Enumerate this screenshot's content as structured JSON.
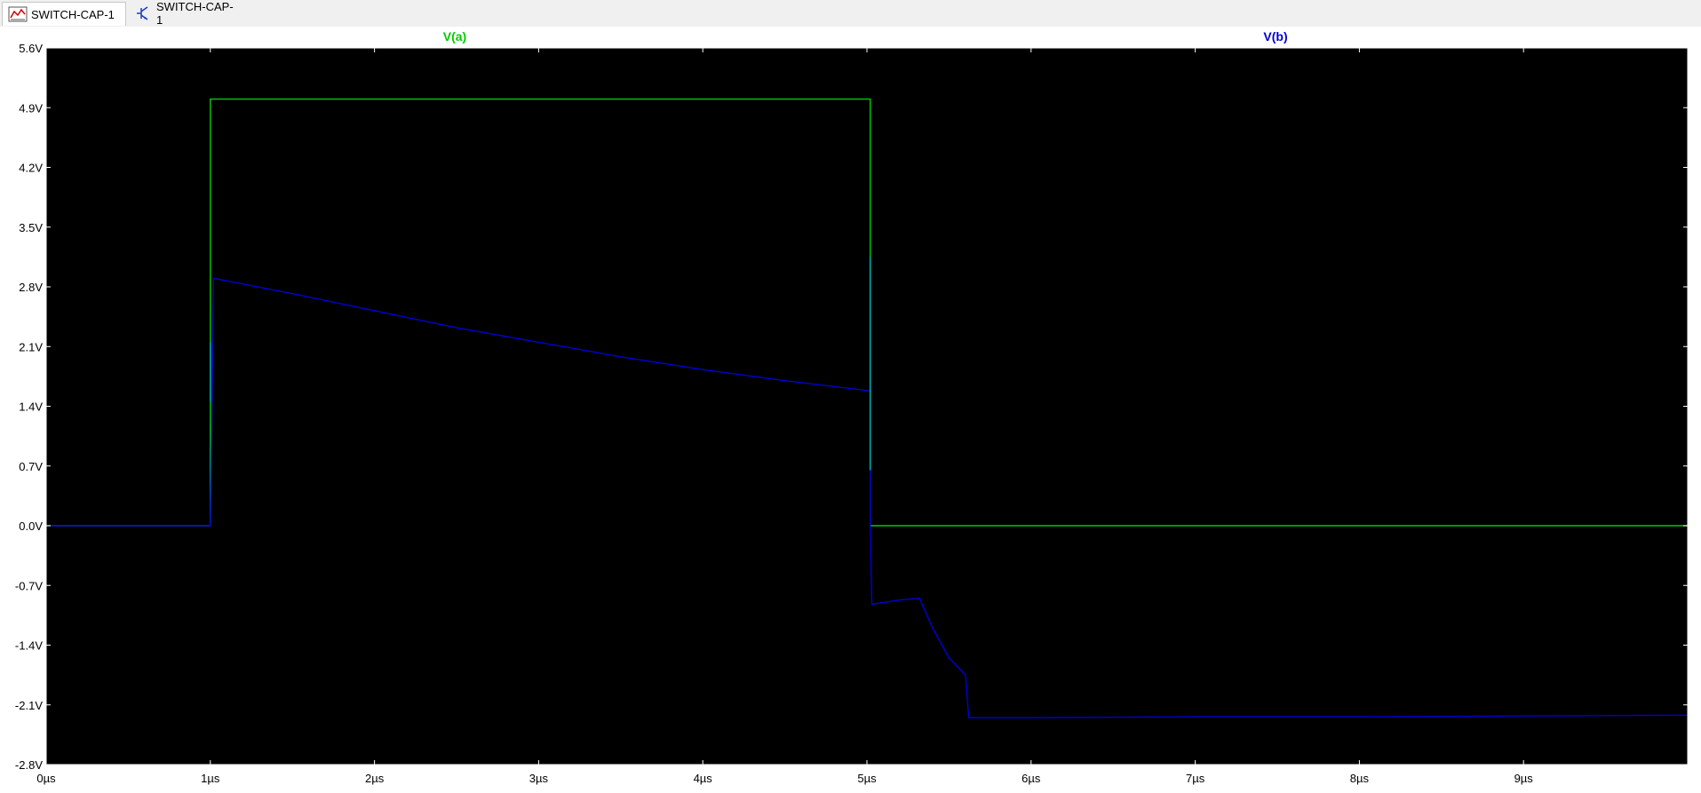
{
  "tabs": [
    {
      "label": "SWITCH-CAP-1",
      "icon": "waveform-icon",
      "active": true
    },
    {
      "label": "SWITCH-CAP-1",
      "icon": "schematic-icon",
      "active": false
    }
  ],
  "colors": {
    "plot_background": "#000000",
    "axis_text": "#ffffff",
    "frame": "#ffffff",
    "va_trace": "#00cc00",
    "vb_trace": "#0000d8",
    "vb_glitch": "#00aaaa"
  },
  "chart_data": {
    "type": "line",
    "title": "",
    "xlabel": "",
    "ylabel": "",
    "xlim": [
      0,
      10
    ],
    "ylim": [
      -2.8,
      5.6
    ],
    "grid": false,
    "legend": "top, trace names as headers",
    "y_ticks": [
      5.6,
      4.9,
      4.2,
      3.5,
      2.8,
      2.1,
      1.4,
      0.7,
      0.0,
      -0.7,
      -1.4,
      -2.1,
      -2.8
    ],
    "y_tick_labels": [
      "5.6V",
      "4.9V",
      "4.2V",
      "3.5V",
      "2.8V",
      "2.1V",
      "1.4V",
      "0.7V",
      "0.0V",
      "-0.7V",
      "-1.4V",
      "-2.1V",
      "-2.8V"
    ],
    "x_ticks": [
      0,
      1,
      2,
      3,
      4,
      5,
      6,
      7,
      8,
      9
    ],
    "x_tick_labels": [
      "0µs",
      "1µs",
      "2µs",
      "3µs",
      "4µs",
      "5µs",
      "6µs",
      "7µs",
      "8µs",
      "9µs"
    ],
    "series": [
      {
        "name": "V(a)",
        "color": "#00cc00",
        "x": [
          0,
          1.0,
          1.0,
          5.02,
          5.02,
          10
        ],
        "y": [
          0,
          0,
          5.0,
          5.0,
          0,
          0
        ]
      },
      {
        "name": "V(b)",
        "color": "#0000d8",
        "x": [
          0,
          1.0,
          1.02,
          1.5,
          2.0,
          2.5,
          3.0,
          3.5,
          4.0,
          4.5,
          5.02,
          5.02,
          5.03,
          5.2,
          5.32,
          5.4,
          5.5,
          5.6,
          5.62,
          6.0,
          7.0,
          8.0,
          9.0,
          10
        ],
        "y": [
          0,
          0,
          2.9,
          2.72,
          2.52,
          2.32,
          2.15,
          1.98,
          1.83,
          1.7,
          1.58,
          0.0,
          -0.92,
          -0.87,
          -0.85,
          -1.2,
          -1.55,
          -1.75,
          -2.25,
          -2.25,
          -2.24,
          -2.24,
          -2.23,
          -2.22
        ]
      }
    ]
  }
}
